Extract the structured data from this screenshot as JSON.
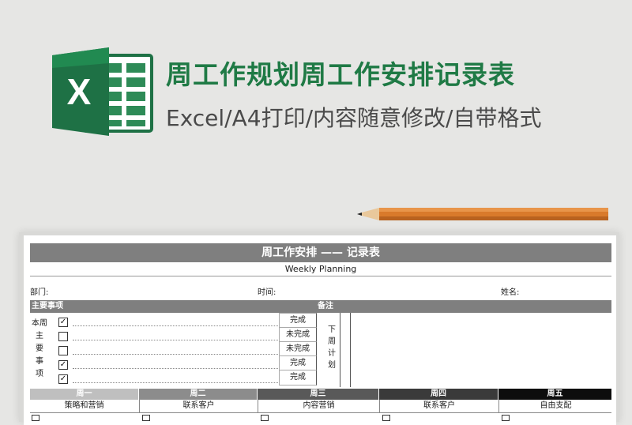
{
  "banner": {
    "title": "周工作规划周工作安排记录表",
    "subtitle": "Excel/A4打印/内容随意修改/自带格式",
    "logo_letter": "X",
    "colors": {
      "title": "#1f7a45",
      "excel_green": "#1e7145",
      "excel_dark": "#185c37"
    }
  },
  "sheet": {
    "header_title": "周工作安排 —— 记录表",
    "header_en": "Weekly Planning",
    "dept_label": "部门:",
    "time_label": "时间:",
    "name_label": "姓名:",
    "main_items_label": "主要事项",
    "remarks_label": "备注",
    "side_label": [
      "本周",
      "主",
      "要",
      "事",
      "项"
    ],
    "items": [
      {
        "checked": true,
        "status": "完成"
      },
      {
        "checked": false,
        "status": "未完成"
      },
      {
        "checked": false,
        "status": "未完成"
      },
      {
        "checked": true,
        "status": "完成"
      },
      {
        "checked": true,
        "status": "完成"
      }
    ],
    "next_plan": [
      "下",
      "周",
      "计",
      "划"
    ],
    "days": [
      {
        "label": "周一",
        "sub": "策略和营销",
        "color": "#bfbfbf"
      },
      {
        "label": "周二",
        "sub": "联系客户",
        "color": "#8c8c8c"
      },
      {
        "label": "周三",
        "sub": "内容营销",
        "color": "#595959"
      },
      {
        "label": "周四",
        "sub": "联系客户",
        "color": "#3a3a3a"
      },
      {
        "label": "周五",
        "sub": "自由支配",
        "color": "#0d0d0d"
      }
    ],
    "check_mark": "✓"
  }
}
